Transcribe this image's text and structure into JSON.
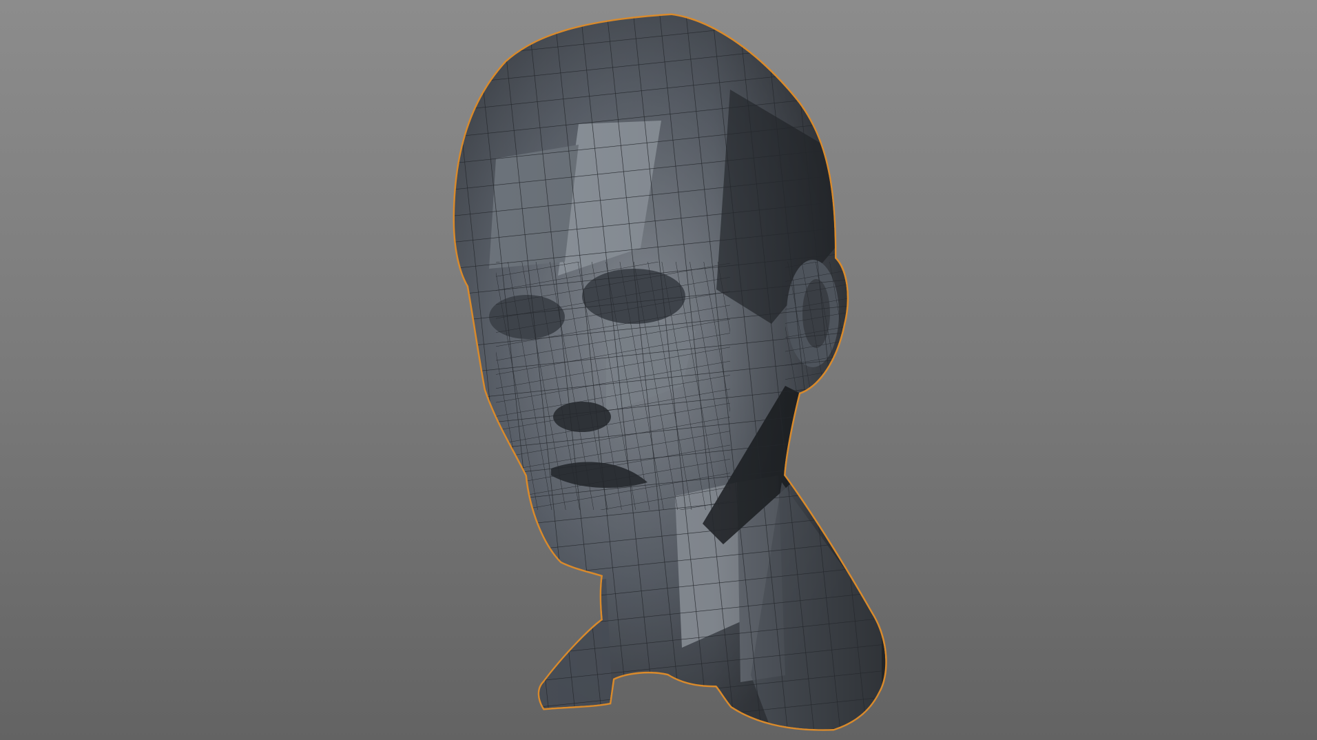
{
  "viewport": {
    "background_top": "#8c8c8c",
    "background_bottom": "#636363"
  },
  "mesh": {
    "subject": "head-and-neck",
    "display_mode": "shaded-wireframe",
    "selected": true,
    "outline_color": "#d98a2b",
    "base_color": "#4a5059",
    "wire_color": "#23262b"
  }
}
